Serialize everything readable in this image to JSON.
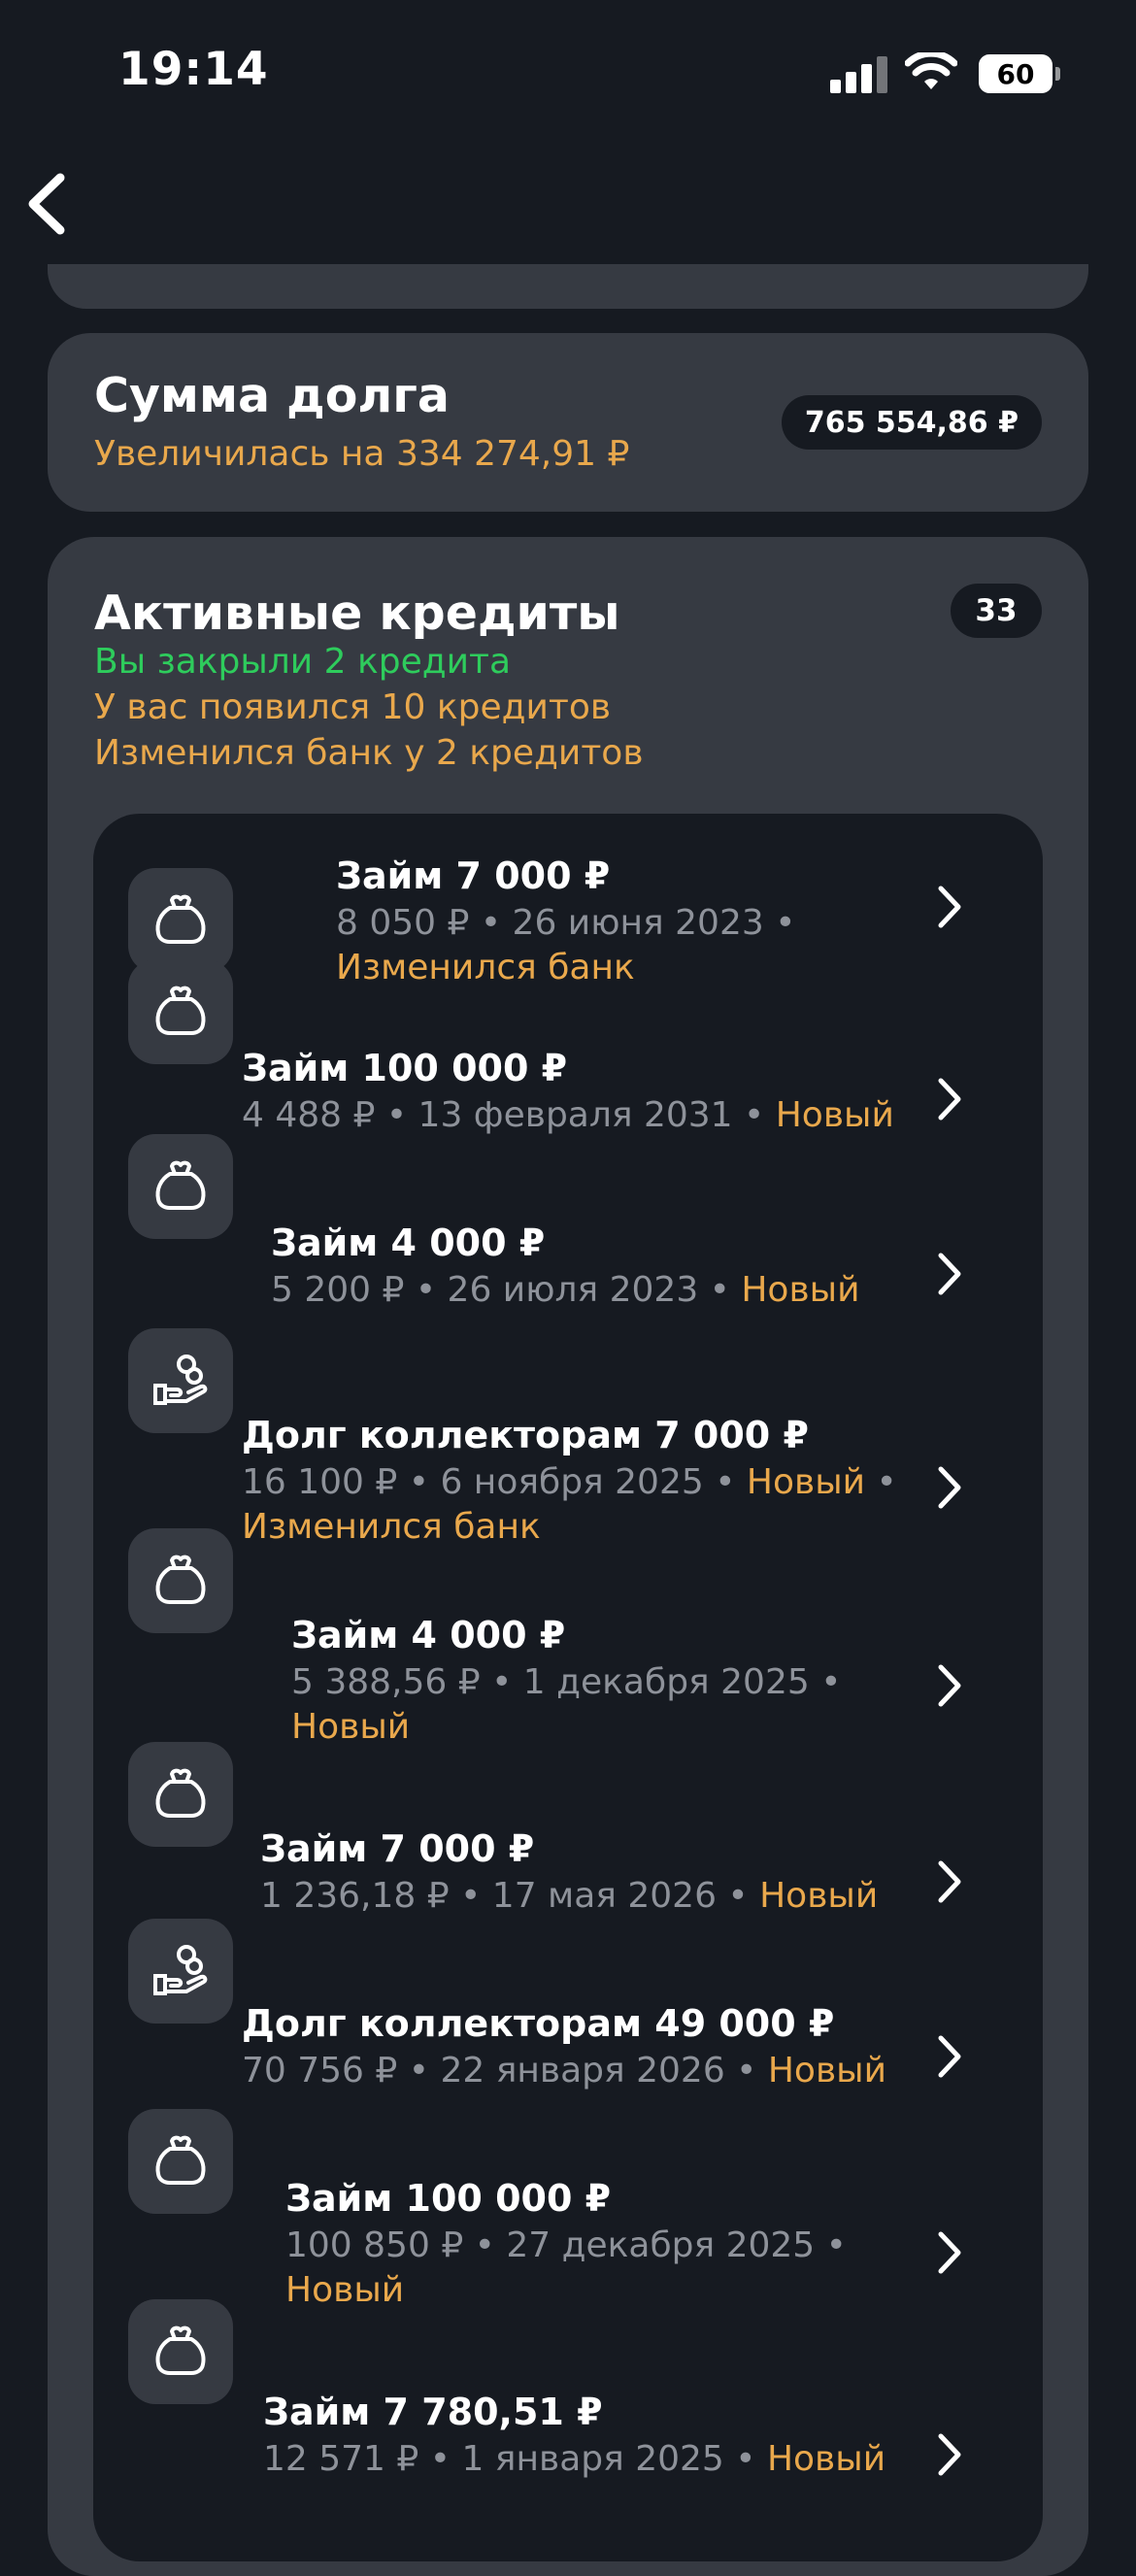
{
  "status_bar": {
    "time": "19:14",
    "battery": "60"
  },
  "debt": {
    "title": "Сумма долга",
    "subtitle": "Увеличилась на 334 274,91 ₽",
    "amount": "765 554,86 ₽"
  },
  "active": {
    "title": "Активные кредиты",
    "count": "33",
    "notes": [
      "Вы закрыли 2 кредита",
      "У вас появился 10 кредитов",
      "Изменился банк у 2 кредитов"
    ]
  },
  "sep": " • ",
  "loans": [
    {
      "icon": "wallet-icon",
      "name": "Займ 7 000 ₽",
      "amount": "8 050 ₽",
      "date": "26 июня 2023",
      "tag": "Изменился банк"
    },
    {
      "icon": "wallet-icon",
      "name": "Займ 100 000 ₽",
      "amount": "4 488 ₽",
      "date": "13 февраля 2031",
      "tag": "Новый"
    },
    {
      "icon": "wallet-icon",
      "name": "Займ 4 000 ₽",
      "amount": "5 200 ₽",
      "date": "26 июля 2023",
      "tag": "Новый"
    },
    {
      "icon": "hand-coins-icon",
      "name": "Долг коллекторам 7 000 ₽",
      "amount": "16 100 ₽",
      "date": "6 ноября 2025",
      "tag": "Новый",
      "tag2": "Изменился банк"
    },
    {
      "icon": "wallet-icon",
      "name": "Займ 4 000 ₽",
      "amount": "5 388,56 ₽",
      "date": "1 декабря 2025",
      "tag": "Новый"
    },
    {
      "icon": "wallet-icon",
      "name": "Займ 7 000 ₽",
      "amount": "1 236,18 ₽",
      "date": "17 мая 2026",
      "tag": "Новый"
    },
    {
      "icon": "hand-coins-icon",
      "name": "Долг коллекторам 49 000 ₽",
      "amount": "70 756 ₽",
      "date": "22 января 2026",
      "tag": "Новый"
    },
    {
      "icon": "wallet-icon",
      "name": "Займ 100 000 ₽",
      "amount": "100 850 ₽",
      "date": "27 декабря 2025",
      "tag": "Новый"
    },
    {
      "icon": "wallet-icon",
      "name": "Займ 7 780,51 ₽",
      "amount": "12 571 ₽",
      "date": "1 января 2025",
      "tag": "Новый"
    }
  ]
}
